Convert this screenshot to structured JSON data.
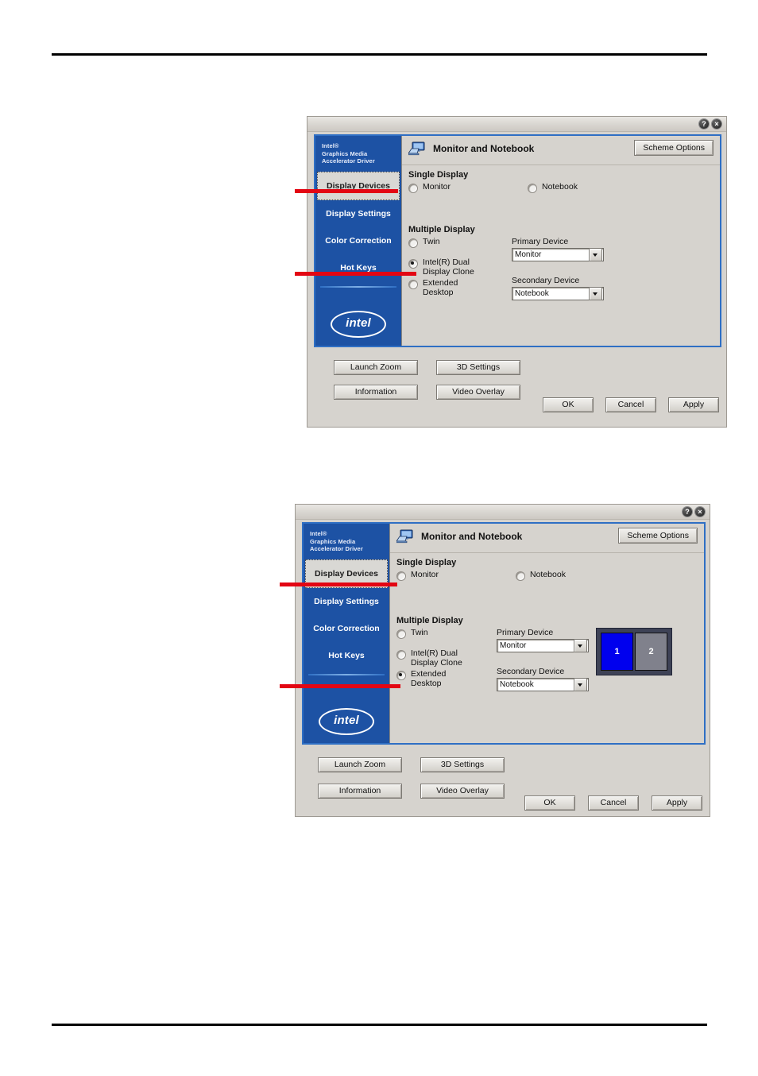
{
  "page": {
    "has_top_rule": true,
    "has_bottom_rule": true
  },
  "dialog1": {
    "titlebar": {
      "help_icon_label": "?",
      "close_icon_label": "×"
    },
    "sidebar": {
      "brand_line1": "Intel®",
      "brand_line2": "Graphics Media",
      "brand_line3": "Accelerator Driver",
      "items": [
        {
          "label": "Display Devices",
          "selected": true
        },
        {
          "label": "Display Settings",
          "selected": false
        },
        {
          "label": "Color Correction",
          "selected": false
        },
        {
          "label": "Hot Keys",
          "selected": false
        }
      ],
      "logo_text": "intel"
    },
    "header": {
      "icon": "monitor-notebook-icon",
      "title": "Monitor and Notebook",
      "scheme_options_label": "Scheme Options"
    },
    "single_display": {
      "group_label": "Single Display",
      "options": [
        {
          "label": "Monitor",
          "selected": false
        },
        {
          "label": "Notebook",
          "selected": false
        }
      ]
    },
    "multiple_display": {
      "group_label": "Multiple Display",
      "options": [
        {
          "label": "Twin",
          "selected": false
        },
        {
          "label": "Intel(R) Dual\nDisplay Clone",
          "selected": true
        },
        {
          "label": "Extended\nDesktop",
          "selected": false
        }
      ],
      "primary_device": {
        "label": "Primary Device",
        "value": "Monitor"
      },
      "secondary_device": {
        "label": "Secondary Device",
        "value": "Notebook"
      },
      "preview_visible": false
    },
    "footer": {
      "launch_zoom": "Launch Zoom",
      "three_d_settings": "3D Settings",
      "information": "Information",
      "video_overlay": "Video Overlay",
      "ok": "OK",
      "cancel": "Cancel",
      "apply": "Apply"
    }
  },
  "dialog2": {
    "titlebar": {
      "help_icon_label": "?",
      "close_icon_label": "×"
    },
    "sidebar": {
      "brand_line1": "Intel®",
      "brand_line2": "Graphics Media",
      "brand_line3": "Accelerator Driver",
      "items": [
        {
          "label": "Display Devices",
          "selected": true
        },
        {
          "label": "Display Settings",
          "selected": false
        },
        {
          "label": "Color Correction",
          "selected": false
        },
        {
          "label": "Hot Keys",
          "selected": false
        }
      ],
      "logo_text": "intel"
    },
    "header": {
      "icon": "monitor-notebook-icon",
      "title": "Monitor and Notebook",
      "scheme_options_label": "Scheme Options"
    },
    "single_display": {
      "group_label": "Single Display",
      "options": [
        {
          "label": "Monitor",
          "selected": false
        },
        {
          "label": "Notebook",
          "selected": false
        }
      ]
    },
    "multiple_display": {
      "group_label": "Multiple Display",
      "options": [
        {
          "label": "Twin",
          "selected": false
        },
        {
          "label": "Intel(R) Dual\nDisplay Clone",
          "selected": false
        },
        {
          "label": "Extended\nDesktop",
          "selected": true
        }
      ],
      "primary_device": {
        "label": "Primary Device",
        "value": "Monitor"
      },
      "secondary_device": {
        "label": "Secondary Device",
        "value": "Notebook"
      },
      "preview_visible": true,
      "preview": {
        "monitor1_number": "1",
        "monitor1_color": "#0000ee",
        "monitor2_number": "2",
        "monitor2_color": "#80818c",
        "background_color": "#3e4256"
      }
    },
    "footer": {
      "launch_zoom": "Launch Zoom",
      "three_d_settings": "3D Settings",
      "information": "Information",
      "video_overlay": "Video Overlay",
      "ok": "OK",
      "cancel": "Cancel",
      "apply": "Apply"
    }
  },
  "annotations": {
    "color": "#e30613",
    "pointers": [
      {
        "target": "dialog1-nav-display-devices"
      },
      {
        "target": "dialog1-radio-intel-dual-display-clone"
      },
      {
        "target": "dialog2-radio-monitor"
      },
      {
        "target": "dialog2-radio-extended-desktop"
      }
    ]
  }
}
